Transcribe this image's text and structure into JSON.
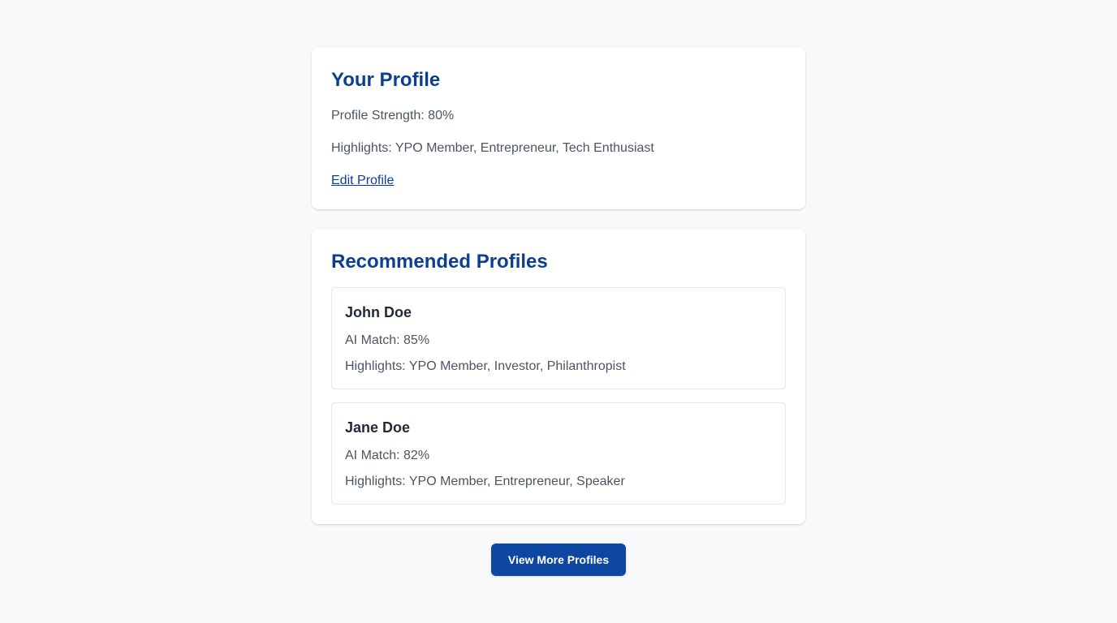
{
  "your_profile": {
    "title": "Your Profile",
    "strength": "Profile Strength: 80%",
    "highlights": "Highlights: YPO Member, Entrepreneur, Tech Enthusiast",
    "edit_link": "Edit Profile"
  },
  "recommended": {
    "title": "Recommended Profiles",
    "profiles": [
      {
        "name": "John Doe",
        "match": "AI Match: 85%",
        "highlights": "Highlights: YPO Member, Investor, Philanthropist"
      },
      {
        "name": "Jane Doe",
        "match": "AI Match: 82%",
        "highlights": "Highlights: YPO Member, Entrepreneur, Speaker"
      }
    ]
  },
  "actions": {
    "view_more_label": "View More Profiles"
  },
  "colors": {
    "accent": "#0d3f91",
    "button": "#0d47a1",
    "background": "#f8f9fb",
    "card": "#ffffff",
    "muted_text": "#4b5563"
  }
}
